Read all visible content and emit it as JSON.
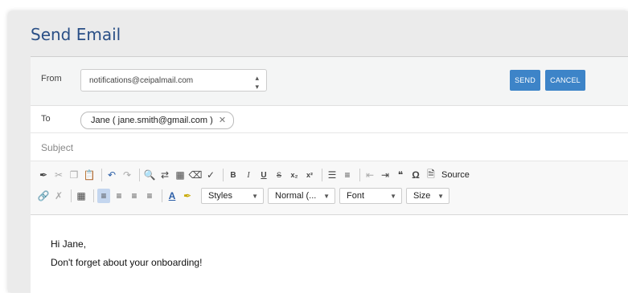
{
  "dialog": {
    "title": "Send Email"
  },
  "from": {
    "label": "From",
    "value": "notifications@ceipalmail.com"
  },
  "buttons": {
    "send": "SEND",
    "cancel": "CANCEL"
  },
  "to": {
    "label": "To",
    "recipients": [
      {
        "display": "Jane ( jane.smith@gmail.com )"
      }
    ],
    "remove_glyph": "✕"
  },
  "subject": {
    "placeholder": "Subject",
    "value": ""
  },
  "toolbar": {
    "source_label": "Source",
    "styles_combo": "Styles",
    "format_combo": "Normal (...",
    "font_combo": "Font",
    "size_combo": "Size"
  },
  "editor": {
    "lines": [
      "Hi Jane,",
      "Don't forget about your onboarding!"
    ]
  },
  "colors": {
    "accent": "#3d84c8",
    "title": "#2a4f86"
  }
}
